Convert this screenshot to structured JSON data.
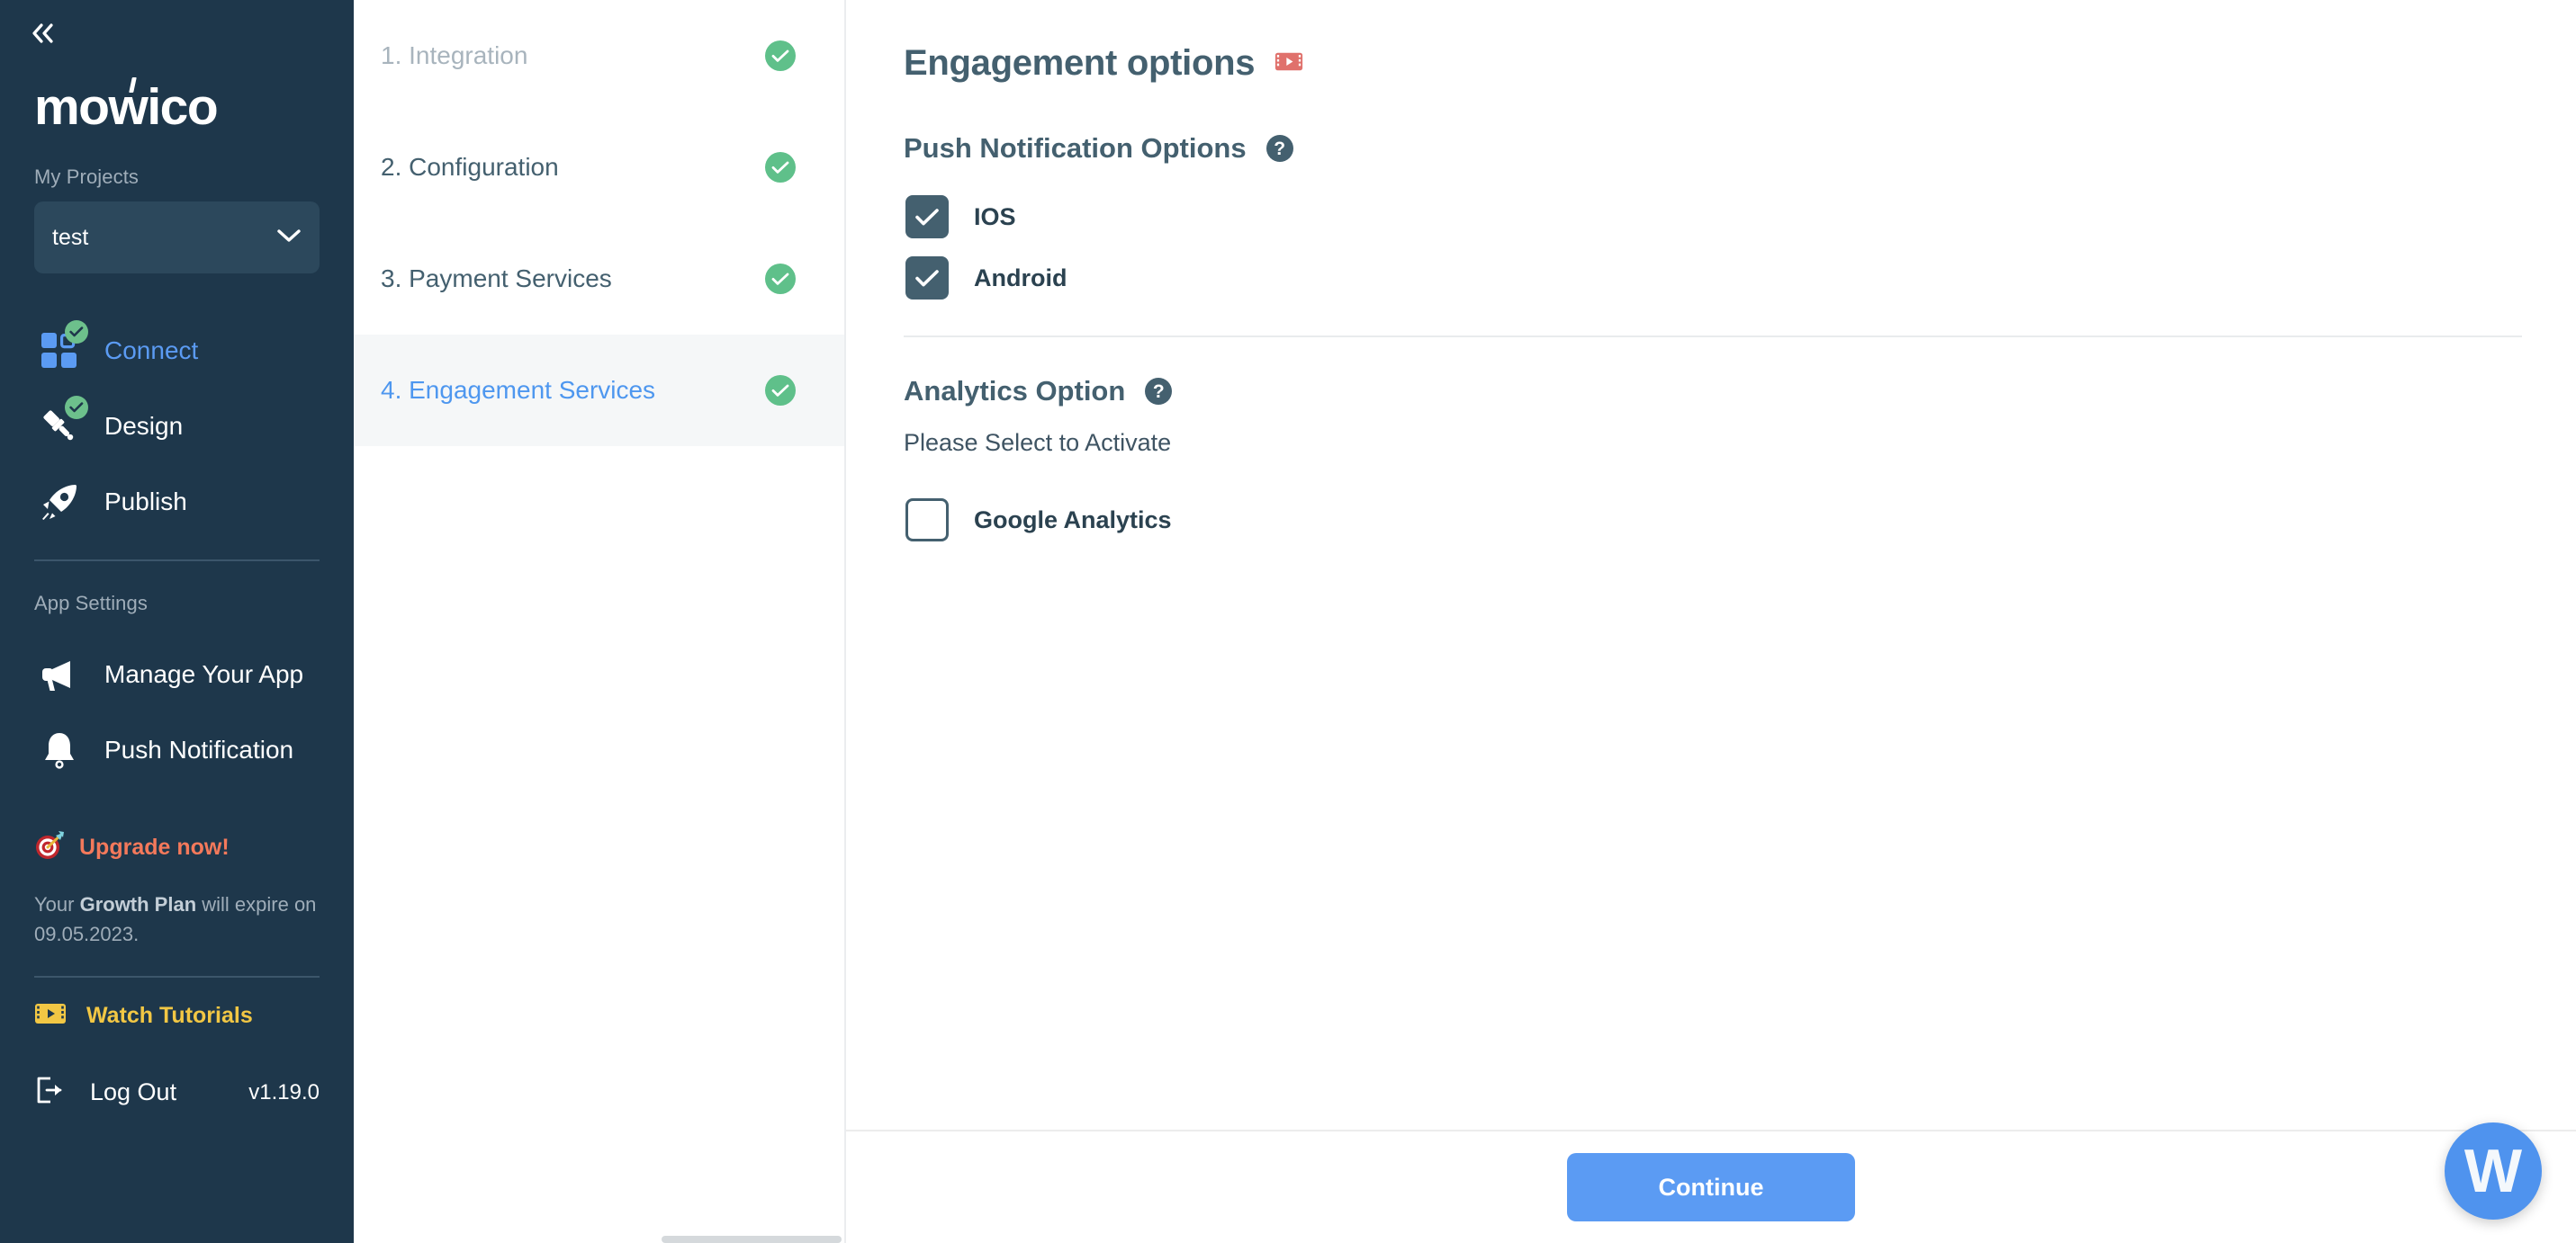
{
  "sidebar": {
    "collapse_icon": "chevrons-left-icon",
    "logo_text": "mowico",
    "projects_label": "My Projects",
    "project_selected": "test",
    "project_chevron_icon": "chevron-down-icon",
    "nav": [
      {
        "label": "Connect",
        "icon": "grid-blocks-icon",
        "completed": true,
        "active": true
      },
      {
        "label": "Design",
        "icon": "paint-brush-icon",
        "completed": true,
        "active": false
      },
      {
        "label": "Publish",
        "icon": "rocket-icon",
        "completed": false,
        "active": false
      }
    ],
    "settings_label": "App Settings",
    "settings": [
      {
        "label": "Manage Your App",
        "icon": "megaphone-icon"
      },
      {
        "label": "Push Notification",
        "icon": "bell-icon"
      }
    ],
    "upgrade": {
      "icon": "dart-target-icon",
      "label": "Upgrade now!",
      "note_prefix": "Your ",
      "note_plan": "Growth Plan",
      "note_suffix": " will expire on 09.05.2023."
    },
    "tutorials": {
      "icon": "video-ticket-icon",
      "label": "Watch Tutorials"
    },
    "logout": {
      "icon": "logout-icon",
      "label": "Log Out"
    },
    "version": "v1.19.0"
  },
  "steps": [
    {
      "label": "1. Integration",
      "state": "done"
    },
    {
      "label": "2. Configuration",
      "state": "done"
    },
    {
      "label": "3. Payment Services",
      "state": "done"
    },
    {
      "label": "4. Engagement Services",
      "state": "current"
    }
  ],
  "main": {
    "title": "Engagement options",
    "title_icon": "video-ticket-icon",
    "push_section": {
      "heading": "Push Notification Options",
      "help_icon": "question-mark-icon",
      "help_glyph": "?",
      "options": [
        {
          "label": "IOS",
          "checked": true
        },
        {
          "label": "Android",
          "checked": true
        }
      ]
    },
    "analytics_section": {
      "heading": "Analytics Option",
      "help_icon": "question-mark-icon",
      "help_glyph": "?",
      "note": "Please Select to Activate",
      "options": [
        {
          "label": "Google Analytics",
          "checked": false
        }
      ]
    },
    "continue_label": "Continue"
  },
  "widget": {
    "letter": "W",
    "name": "support-widget"
  },
  "colors": {
    "sidebar_bg": "#1e374b",
    "accent_blue": "#5b9bf3",
    "green_check": "#5fc08a",
    "upgrade_orange": "#f4795b",
    "tutorial_yellow": "#f2c744",
    "text_dark": "#44606f",
    "red_ticket": "#e0716c"
  }
}
